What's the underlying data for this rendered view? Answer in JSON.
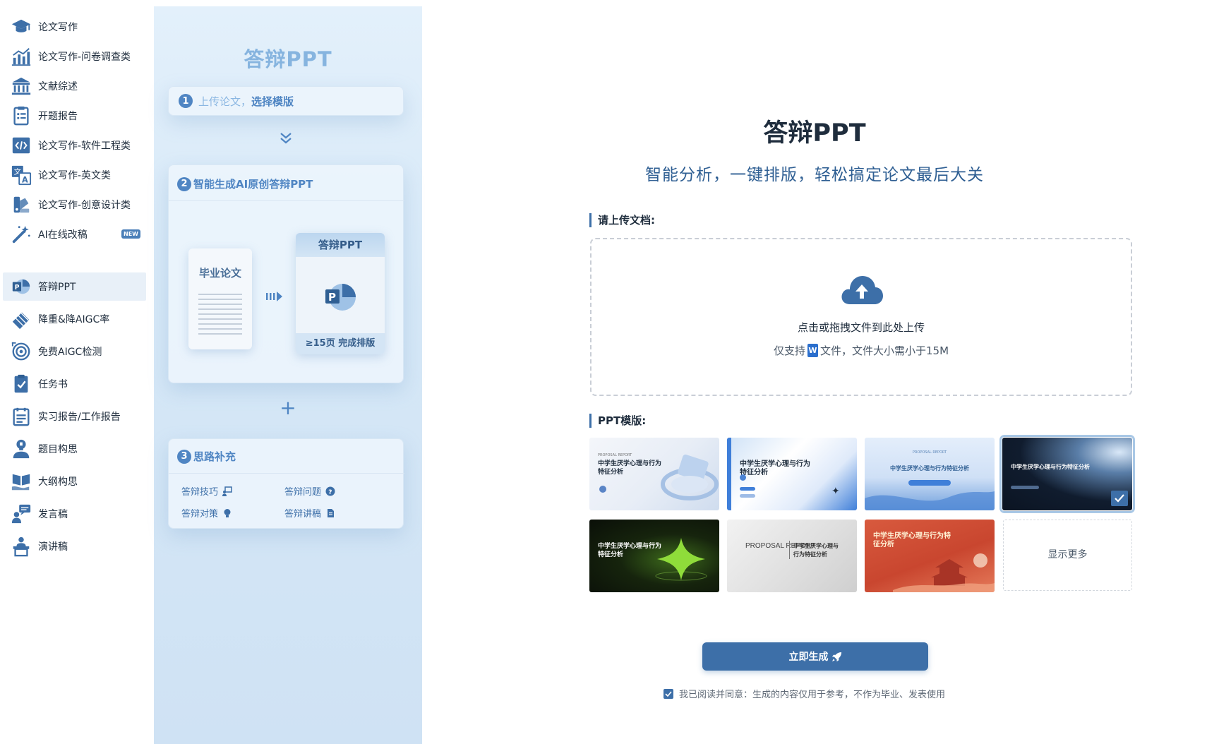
{
  "sidebar": {
    "items": [
      {
        "label": "论文写作",
        "icon": "graduation-cap-icon"
      },
      {
        "label": "论文写作-问卷调查类",
        "icon": "bar-chart-icon"
      },
      {
        "label": "文献综述",
        "icon": "library-icon"
      },
      {
        "label": "开题报告",
        "icon": "clipboard-list-icon"
      },
      {
        "label": "论文写作-软件工程类",
        "icon": "code-icon"
      },
      {
        "label": "论文写作-英文类",
        "icon": "translate-icon"
      },
      {
        "label": "论文写作-创意设计类",
        "icon": "design-swatch-icon"
      },
      {
        "label": "AI在线改稿",
        "icon": "magic-wand-icon",
        "badge": "NEW"
      },
      {
        "label": "答辩PPT",
        "icon": "ppt-icon",
        "active": true
      },
      {
        "label": "降重&降AIGC率",
        "icon": "eraser-icon"
      },
      {
        "label": "免费AIGC检测",
        "icon": "scan-target-icon"
      },
      {
        "label": "任务书",
        "icon": "clipboard-check-icon"
      },
      {
        "label": "实习报告/工作报告",
        "icon": "report-icon"
      },
      {
        "label": "题目构思",
        "icon": "lightbulb-user-icon"
      },
      {
        "label": "大纲构思",
        "icon": "open-book-hand-icon"
      },
      {
        "label": "发言稿",
        "icon": "speech-bubble-user-icon"
      },
      {
        "label": "演讲稿",
        "icon": "podium-icon"
      }
    ]
  },
  "intro": {
    "title": "答辩PPT",
    "step1": {
      "num": "1",
      "text_light": "上传论文，",
      "text_bold": "选择模版"
    },
    "step2": {
      "num": "2",
      "text": "智能生成AI原创答辩PPT",
      "doc_label": "毕业论文",
      "ppt_label": "答辩PPT",
      "ppt_footer": "≥15页 完成排版"
    },
    "plus": "+",
    "step3": {
      "num": "3",
      "text": "思路补充",
      "tips": [
        {
          "label": "答辩技巧",
          "icon": "presenter-icon"
        },
        {
          "label": "答辩问题",
          "icon": "question-circle-icon"
        },
        {
          "label": "答辩对策",
          "icon": "lightbulb-icon"
        },
        {
          "label": "答辩讲稿",
          "icon": "document-icon"
        }
      ]
    }
  },
  "main": {
    "title": "答辩PPT",
    "subtitle": "智能分析，一键排版，轻松搞定论文最后大关",
    "upload_label": "请上传文档:",
    "upload_main": "点击或拖拽文件到此处上传",
    "upload_hint_pre": "仅支持",
    "upload_hint_icon": "W",
    "upload_hint_post": "文件，文件大小需小于15M",
    "template_label": "PPT模版:",
    "templates": [
      {
        "title": "中学生厌学心理与行为特征分析",
        "tag": "PROPOSAL REPORT"
      },
      {
        "title": "中学生厌学心理与行为特征分析",
        "tag": ""
      },
      {
        "title": "中学生厌学心理与行为特征分析",
        "tag": "PROPOSAL REPORT"
      },
      {
        "title": "中学生厌学心理与行为特征分析",
        "tag": "",
        "selected": true
      },
      {
        "title": "中学生厌学心理与行为特征分析",
        "tag": ""
      },
      {
        "title": "中学生厌学心理与行为特征分析",
        "tag": "PROPOSAL REPORT"
      },
      {
        "title": "中学生厌学心理与行为特征分析",
        "tag": ""
      }
    ],
    "show_more": "显示更多",
    "generate_label": "立即生成",
    "agree_text": "我已阅读并同意：生成的内容仅用于参考，不作为毕业、发表使用"
  },
  "colors": {
    "accent": "#3d6fa8",
    "intro_bg": "#d6e8f7",
    "active_item": "#e8f0f8"
  }
}
